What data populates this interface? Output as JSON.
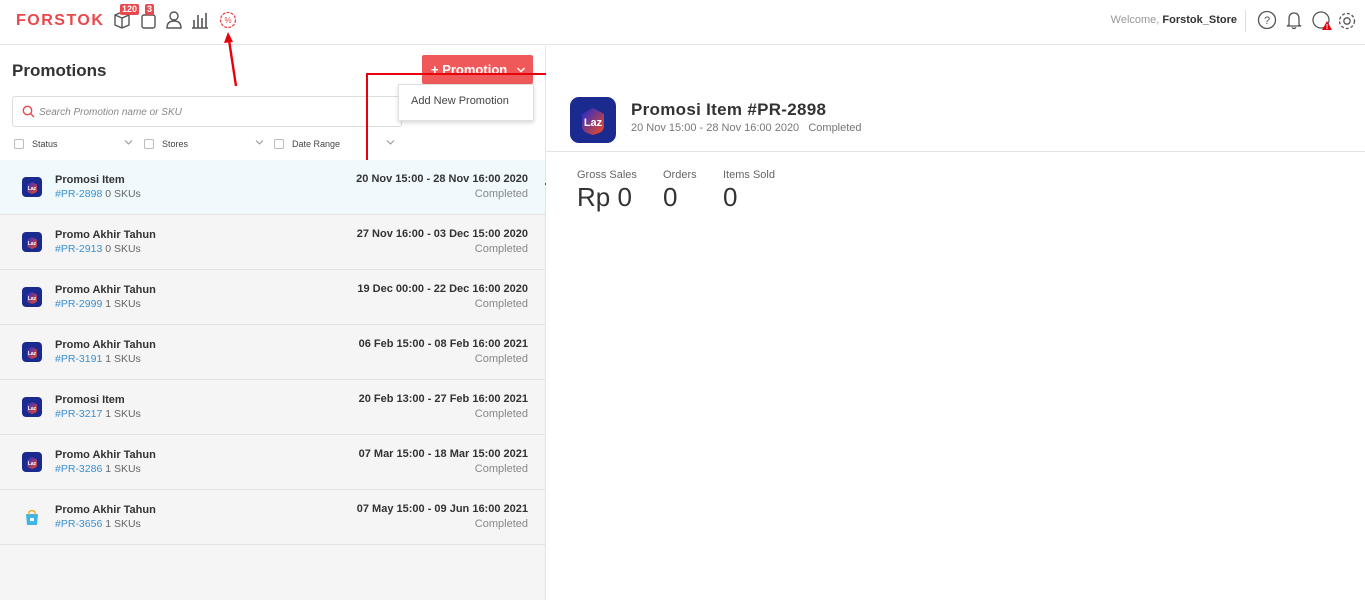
{
  "app": {
    "logo": "FORSTOK",
    "badges": {
      "orders": "120",
      "packages": "3"
    },
    "welcome_prefix": "Welcome, ",
    "user": "Forstok_Store",
    "icons": [
      "box-icon",
      "package-icon",
      "user-icon",
      "bar-chart-icon",
      "promotion-icon",
      "help-icon",
      "bell-icon",
      "alert-icon",
      "gear-icon"
    ]
  },
  "left": {
    "title": "Promotions",
    "promo_button": "+ Promotion",
    "dropdown_item": "Add New Promotion",
    "search_placeholder": "Search Promotion name or SKU",
    "filters": {
      "status": "Status",
      "stores": "Stores",
      "date_range": "Date Range"
    }
  },
  "promotions": [
    {
      "name": "Promosi Item",
      "id": "#PR-2898",
      "skus": "0 SKUs",
      "dates": "20 Nov 15:00 - 28 Nov 16:00 2020",
      "status": "Completed",
      "store": "lazada"
    },
    {
      "name": "Promo Akhir Tahun",
      "id": "#PR-2913",
      "skus": "0 SKUs",
      "dates": "27 Nov 16:00 - 03 Dec 15:00 2020",
      "status": "Completed",
      "store": "lazada"
    },
    {
      "name": "Promo Akhir Tahun",
      "id": "#PR-2999",
      "skus": "1 SKUs",
      "dates": "19 Dec 00:00 - 22 Dec 16:00 2020",
      "status": "Completed",
      "store": "lazada"
    },
    {
      "name": "Promo Akhir Tahun",
      "id": "#PR-3191",
      "skus": "1 SKUs",
      "dates": "06 Feb 15:00 - 08 Feb 16:00 2021",
      "status": "Completed",
      "store": "lazada"
    },
    {
      "name": "Promosi Item",
      "id": "#PR-3217",
      "skus": "1 SKUs",
      "dates": "20 Feb 13:00 - 27 Feb 16:00 2021",
      "status": "Completed",
      "store": "lazada"
    },
    {
      "name": "Promo Akhir Tahun",
      "id": "#PR-3286",
      "skus": "1 SKUs",
      "dates": "07 Mar 15:00 - 18 Mar 15:00 2021",
      "status": "Completed",
      "store": "lazada"
    },
    {
      "name": "Promo Akhir Tahun",
      "id": "#PR-3656",
      "skus": "1 SKUs",
      "dates": "07 May 15:00 - 09 Jun 16:00 2021",
      "status": "Completed",
      "store": "shopping-bag"
    }
  ],
  "detail": {
    "title": "Promosi Item #PR-2898",
    "subtitle": "20 Nov 15:00 - 28 Nov 16:00 2020   Completed",
    "stats": [
      {
        "label": "Gross Sales",
        "value": "Rp 0"
      },
      {
        "label": "Orders",
        "value": "0"
      },
      {
        "label": "Items Sold",
        "value": "0"
      }
    ]
  },
  "colors": {
    "brand": "#e8484b",
    "button": "#f0595a",
    "link": "#3a8fd0",
    "highlight": "#e8000b",
    "lazada_start": "#1b2bd6",
    "lazada_end": "#f74a1a"
  }
}
